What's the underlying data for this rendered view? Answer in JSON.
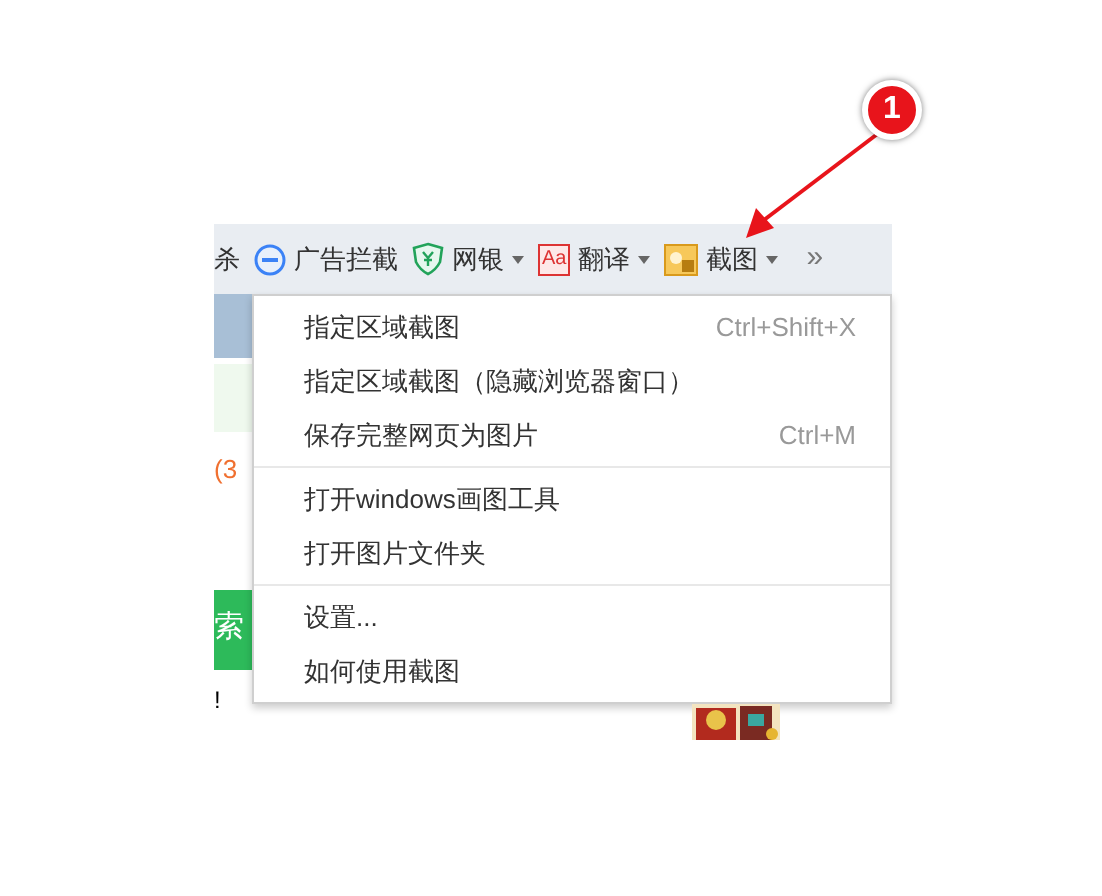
{
  "toolbar": {
    "cut_label": "杀",
    "items": [
      {
        "kind": "block",
        "label": "广告拦截",
        "dropdown": false
      },
      {
        "kind": "bank",
        "label": "网银",
        "dropdown": true
      },
      {
        "kind": "translate",
        "icon_text": "Aa",
        "label": "翻译",
        "dropdown": true
      },
      {
        "kind": "screenshot",
        "label": "截图",
        "dropdown": true
      }
    ],
    "overflow": "»"
  },
  "page_fragments": {
    "count_text": "(3",
    "search_char": "索",
    "mark": "!"
  },
  "menu": {
    "sections": [
      {
        "items": [
          {
            "label": "指定区域截图",
            "shortcut": "Ctrl+Shift+X"
          },
          {
            "label": "指定区域截图（隐藏浏览器窗口）"
          },
          {
            "label": "保存完整网页为图片",
            "shortcut": "Ctrl+M"
          }
        ]
      },
      {
        "items": [
          {
            "label": "打开windows画图工具"
          },
          {
            "label": "打开图片文件夹"
          }
        ]
      },
      {
        "items": [
          {
            "label": "设置..."
          },
          {
            "label": "如何使用截图"
          }
        ]
      }
    ]
  },
  "annotation": {
    "number": "1"
  }
}
